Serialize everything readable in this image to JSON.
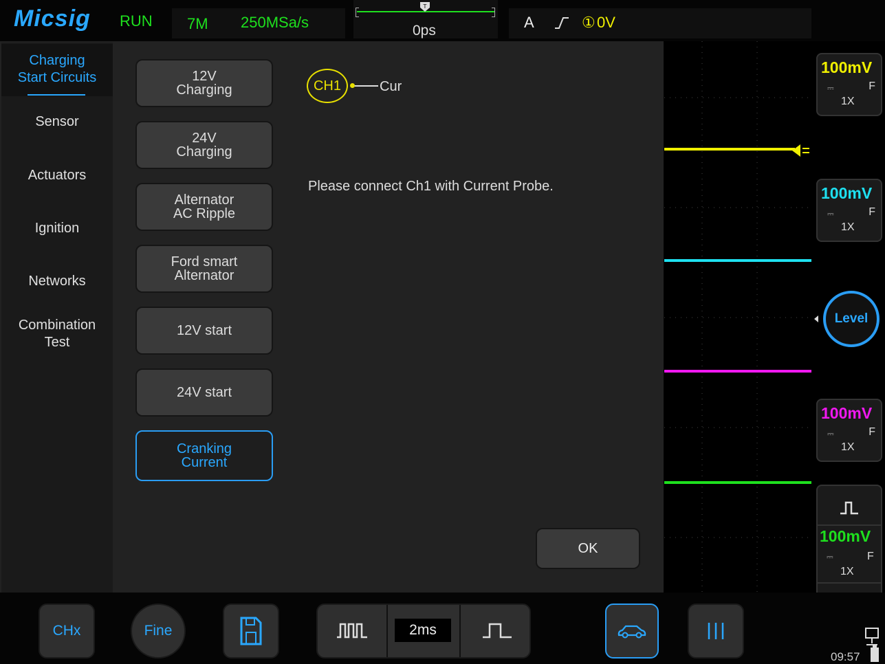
{
  "brand": "Micsig",
  "status": {
    "run": "RUN",
    "memory": "7M",
    "sample_rate": "250MSa/s",
    "time_offset": "0ps"
  },
  "trigger": {
    "source_mode": "A",
    "edge": "rising",
    "channel": "①",
    "level": "0V"
  },
  "nav": {
    "items": [
      {
        "label": "Charging\nStart Circuits",
        "active": true
      },
      {
        "label": "Sensor"
      },
      {
        "label": "Actuators"
      },
      {
        "label": "Ignition"
      },
      {
        "label": "Networks"
      },
      {
        "label": "Combination\nTest"
      }
    ]
  },
  "tests": [
    {
      "label": "12V\nCharging"
    },
    {
      "label": "24V\nCharging"
    },
    {
      "label": "Alternator\nAC Ripple"
    },
    {
      "label": "Ford smart\nAlternator"
    },
    {
      "label": "12V start"
    },
    {
      "label": "24V start"
    },
    {
      "label": "Cranking\nCurrent",
      "selected": true
    }
  ],
  "connection": {
    "channel": "CH1",
    "probe": "Cur",
    "message": "Please connect Ch1 with Current Probe."
  },
  "ok_label": "OK",
  "channels": [
    {
      "scale": "100mV",
      "coupling": "F",
      "probe": "1X",
      "color": "#f0f000"
    },
    {
      "scale": "100mV",
      "coupling": "F",
      "probe": "1X",
      "color": "#1ee0f0"
    },
    {
      "scale": "100mV",
      "coupling": "F",
      "probe": "1X",
      "color": "#f018f0"
    },
    {
      "scale": "100mV",
      "coupling": "F",
      "probe": "1X",
      "color": "#1ee01e"
    }
  ],
  "level_label": "Level",
  "bottom": {
    "chx": "CHx",
    "fine": "Fine",
    "timebase": "2ms"
  },
  "clock": "09:57",
  "colors": {
    "accent": "#2aa8ff",
    "green": "#1ee01e",
    "yellow": "#f0f000",
    "cyan": "#1ee0f0",
    "magenta": "#f018f0"
  }
}
